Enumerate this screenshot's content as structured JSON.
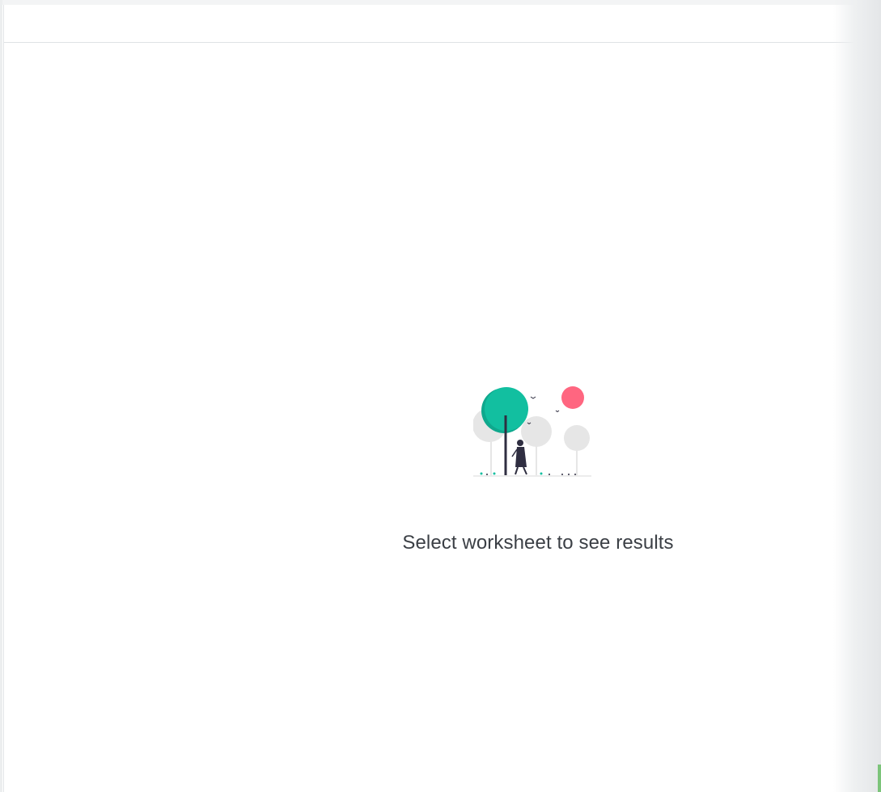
{
  "empty_state": {
    "illustration": "walking-in-park-illustration",
    "message": "Select worksheet to see results"
  },
  "colors": {
    "tree_primary": "#12b59a",
    "sun": "#ff6680",
    "trees_secondary": "#e6e6e6",
    "figure": "#2f2e41",
    "text": "#3b3f45"
  }
}
